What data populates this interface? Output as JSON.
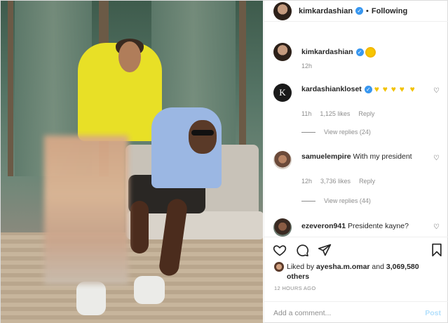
{
  "header": {
    "username": "kimkardashian",
    "verified_glyph": "✓",
    "separator": "•",
    "follow_label": "Following"
  },
  "caption": {
    "username": "kimkardashian",
    "time": "12h"
  },
  "comments": [
    {
      "username": "kardashiankloset",
      "avatar_letter": "K",
      "text": "",
      "hearts": [
        "♥",
        "♥",
        "♥",
        "♥",
        "♥"
      ],
      "time": "11h",
      "likes": "1,125 likes",
      "reply_label": "Reply",
      "view_replies": "View replies (24)"
    },
    {
      "username": "samuelempire",
      "text": "With my president",
      "time": "12h",
      "likes": "3,736 likes",
      "reply_label": "Reply",
      "view_replies": "View replies (44)"
    },
    {
      "username": "ezeveron941",
      "text": "Presidente kayne?"
    }
  ],
  "liked_by": {
    "prefix": "Liked by",
    "user": "ayesha.m.omar",
    "and": "and",
    "count": "3,069,580 others"
  },
  "timestamp": "12 HOURS AGO",
  "add_comment": {
    "placeholder": "Add a comment...",
    "post_label": "Post"
  },
  "colors": {
    "verified": "#3897f0",
    "muted": "#8e8e8e",
    "post_disabled": "#b2dffc"
  }
}
